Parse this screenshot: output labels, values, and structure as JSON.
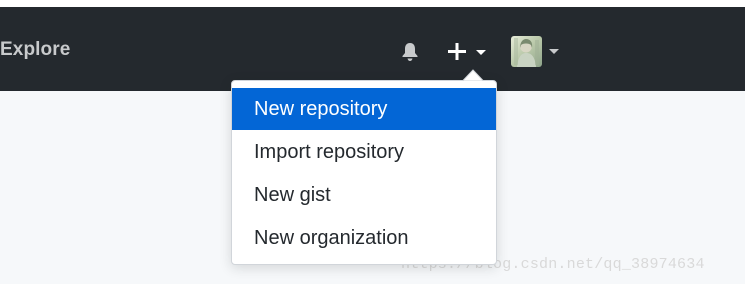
{
  "header": {
    "nav_explore": "Explore",
    "bell_icon": "bell-icon",
    "plus_icon": "plus-icon",
    "caret_icon": "caret-down-icon",
    "avatar_icon": "user-avatar",
    "background": "#24292e"
  },
  "dropdown": {
    "items": [
      {
        "label": "New repository",
        "active": true
      },
      {
        "label": "Import repository",
        "active": false
      },
      {
        "label": "New gist",
        "active": false
      },
      {
        "label": "New organization",
        "active": false
      }
    ],
    "active_color": "#0366d6"
  },
  "watermark": "https://blog.csdn.net/qq_38974634"
}
